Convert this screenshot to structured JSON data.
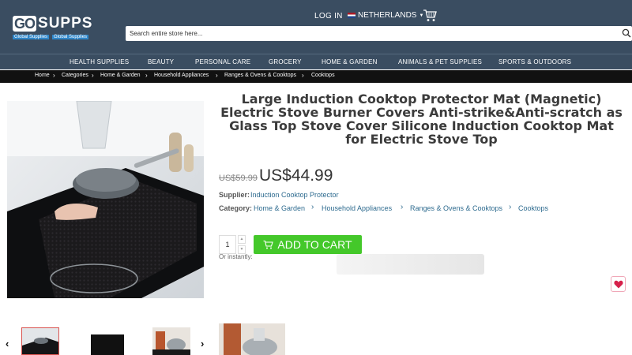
{
  "header": {
    "logo_main_1": "GO",
    "logo_main_2": "SUPPS",
    "logo_tag_1": "Global Supplies",
    "logo_tag_2": "Global Supplies",
    "login": "LOG IN",
    "country": "NETHERLANDS",
    "search_placeholder": "Search entire store here..."
  },
  "nav": {
    "items": [
      "HEALTH SUPPLIES",
      "BEAUTY",
      "PERSONAL CARE",
      "GROCERY",
      "HOME & GARDEN",
      "ANIMALS & PET SUPPLIES",
      "SPORTS & OUTDOORS"
    ]
  },
  "breadcrumb": [
    "Home",
    "Categories",
    "Home & Garden",
    "Household Appliances",
    "Ranges & Ovens & Cooktops",
    "Cooktops"
  ],
  "product": {
    "title": "Large Induction Cooktop Protector Mat (Magnetic) Electric Stove Burner Covers Anti-strike&Anti-scratch as Glass Top Stove Cover Silicone Induction Cooktop Mat for Electric Stove Top",
    "old_price": "US$59.99",
    "price": "US$44.99",
    "supplier_label": "Supplier:",
    "supplier": "Induction Cooktop Protector",
    "category_label": "Category:",
    "categories": [
      "Home & Garden",
      "Household Appliances",
      "Ranges & Ovens & Cooktops",
      "Cooktops"
    ],
    "quantity": "1",
    "add_to_cart": "ADD TO CART",
    "or_instantly": "Or instantly:"
  },
  "colors": {
    "header_bg": "#3a4d61",
    "breadcrumb_bg": "#111111",
    "cart_button": "#44c82a",
    "link": "#2e6b8f"
  }
}
